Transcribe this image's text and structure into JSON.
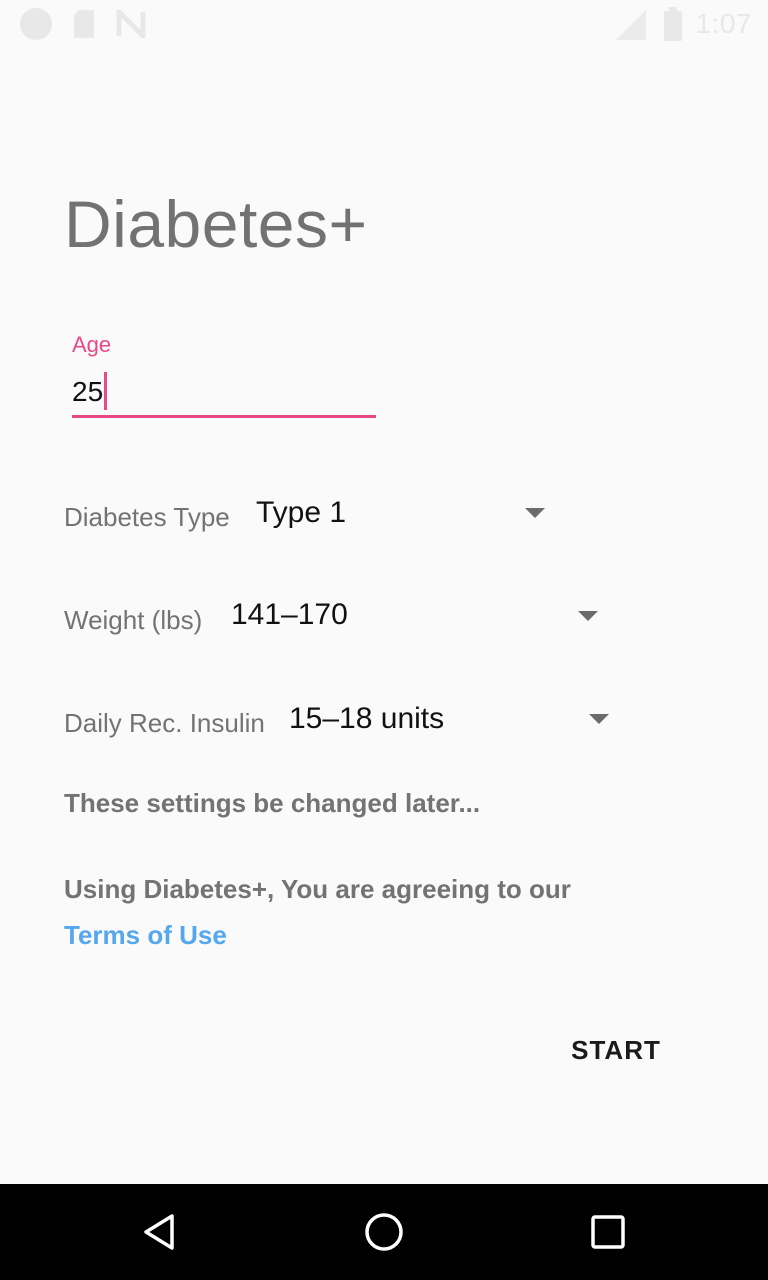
{
  "status_bar": {
    "time": "1:07",
    "icons": [
      "circle-notification-icon",
      "sd-card-icon",
      "n-icon",
      "signal-icon",
      "battery-icon"
    ]
  },
  "app": {
    "title": "Diabetes+"
  },
  "form": {
    "age": {
      "label": "Age",
      "value": "25"
    },
    "diabetes_type": {
      "label": "Diabetes Type",
      "value": "Type 1"
    },
    "weight": {
      "label": "Weight (lbs)",
      "value": "141–170"
    },
    "insulin": {
      "label": "Daily Rec. Insulin",
      "value": "15–18 units"
    }
  },
  "note": "These settings be changed later...",
  "agreement": {
    "text": "Using Diabetes+, You are agreeing to our",
    "link": "Terms of Use"
  },
  "actions": {
    "start_label": "START"
  },
  "colors": {
    "accent": "#e84a87",
    "link": "#55a8ee",
    "background": "#fafafa",
    "navbar": "#000000"
  },
  "nav_bar": {
    "icons": [
      "back-icon",
      "home-icon",
      "recents-icon"
    ]
  }
}
